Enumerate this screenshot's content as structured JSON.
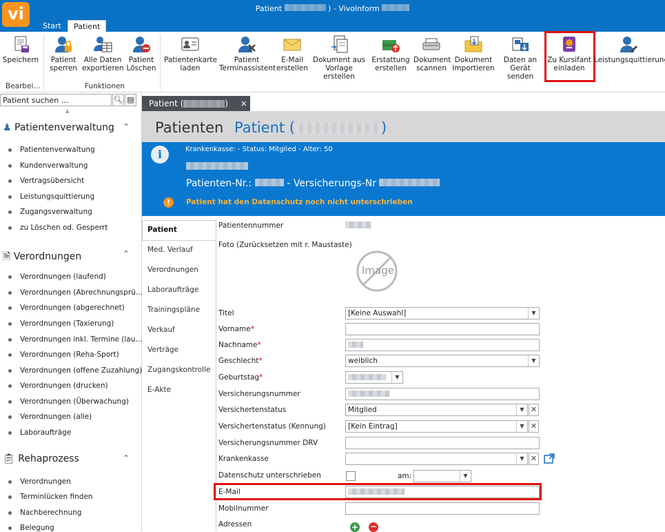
{
  "window": {
    "title_prefix": "Patient",
    "title_suffix": ") - VivoInform",
    "logo": "vi"
  },
  "ribbon_tabs": [
    {
      "label": "Start"
    },
    {
      "label": "Patient"
    }
  ],
  "ribbon": {
    "buttons": [
      {
        "label": "Speichern",
        "icon": "save-document-icon"
      },
      {
        "label": "Patient sperren",
        "icon": "lock-user-icon"
      },
      {
        "label": "Alle Daten exportieren",
        "icon": "export-table-icon"
      },
      {
        "label": "Patient Löschen",
        "icon": "delete-user-icon"
      },
      {
        "label": "Patientenkarte laden",
        "icon": "id-card-icon"
      },
      {
        "label": "Patient Terminassistent",
        "icon": "user-tools-icon"
      },
      {
        "label": "E-Mail erstellen",
        "icon": "envelope-icon"
      },
      {
        "label": "Dokument aus Vorlage erstellen",
        "icon": "document-template-icon"
      },
      {
        "label": "Erstattung erstellen",
        "icon": "money-stack-icon"
      },
      {
        "label": "Dokument scannen",
        "icon": "scanner-icon"
      },
      {
        "label": "Dokument Importieren",
        "icon": "folder-import-icon"
      },
      {
        "label": "Daten an Gerät senden",
        "icon": "device-send-icon"
      },
      {
        "label": "Zu Kursifant einladen",
        "icon": "kursifant-invite-icon"
      },
      {
        "label": "Leistungsquittierung",
        "icon": "user-sign-icon"
      }
    ],
    "groups": [
      "Bearbei…",
      "Funktionen"
    ]
  },
  "nav": {
    "search_placeholder": "Patient suchen …",
    "sections": [
      {
        "title": "Patientenverwaltung",
        "items": [
          "Patientenverwaltung",
          "Kundenverwaltung",
          "Vertragsübersicht",
          "Leistungsquittierung",
          "Zugangsverwaltung",
          "zu Löschen od. Gesperrt"
        ]
      },
      {
        "title": "Verordnungen",
        "items": [
          "Verordnungen (laufend)",
          "Verordnungen (Abrechnungsprü…",
          "Verordnungen (abgerechnet)",
          "Verordnungen (Taxierung)",
          "Verordnungen inkl. Termine (lau…",
          "Verordnungen (Reha-Sport)",
          "Verordnungen (offene Zuzahlung)",
          "Verordnungen (drucken)",
          "Verordnungen (Überwachung)",
          "Verordnungen (alle)",
          "Laboraufträge"
        ]
      },
      {
        "title": "Rehaprozess",
        "items": [
          "Verordnungen",
          "Terminlücken finden",
          "Nachberechnung",
          "Belegung"
        ]
      }
    ]
  },
  "doc_tab": {
    "label": "Patient (",
    "label_end": ")",
    "close": "×"
  },
  "header": {
    "title": "Patienten",
    "subtitle": "Patient (",
    "subtitle_end": ")"
  },
  "info": {
    "line1": "Krankenkasse:  -  Status: Mitglied - Alter: 50",
    "patnr_label": "Patienten-Nr.:",
    "vers_label": "-  Versicherungs-Nr",
    "warning": "Patient hat den Datenschutz noch nicht unterschrieben"
  },
  "subtabs": [
    "Patient",
    "Med. Verlauf",
    "Verordnungen",
    "Laboraufträge",
    "Trainingspläne",
    "Verkauf",
    "Verträge",
    "Zugangskontrolle",
    "E-Akte"
  ],
  "form": {
    "patientennummer_label": "Patientennummer",
    "foto_label": "Foto (Zurücksetzen mit r. Maustaste)",
    "image_placeholder": "Image",
    "titel_label": "Titel",
    "titel_value": "[Keine Auswahl]",
    "vorname_label": "Vorname",
    "nachname_label": "Nachname",
    "geschlecht_label": "Geschlecht",
    "geschlecht_value": "weiblich",
    "geburtstag_label": "Geburtstag",
    "versnr_label": "Versicherungsnummer",
    "versstatus_label": "Versichertenstatus",
    "versstatus_value": "Mitglied",
    "versstatus_kennung_label": "Versichertenstatus (Kennung)",
    "versstatus_kennung_value": "[Kein Eintrag]",
    "versnr_drv_label": "Versicherungsnummer DRV",
    "krankenkasse_label": "Krankenkasse",
    "datenschutz_label": "Datenschutz unterschrieben",
    "am_label": "am:",
    "email_label": "E-Mail",
    "mobil_label": "Mobilnummer",
    "adressen_label": "Adressen",
    "required_mark": "*"
  },
  "colors": {
    "brand": "#0a72c5",
    "info": "#0b78d0",
    "warning": "#f7941d",
    "highlight": "#e01010"
  }
}
